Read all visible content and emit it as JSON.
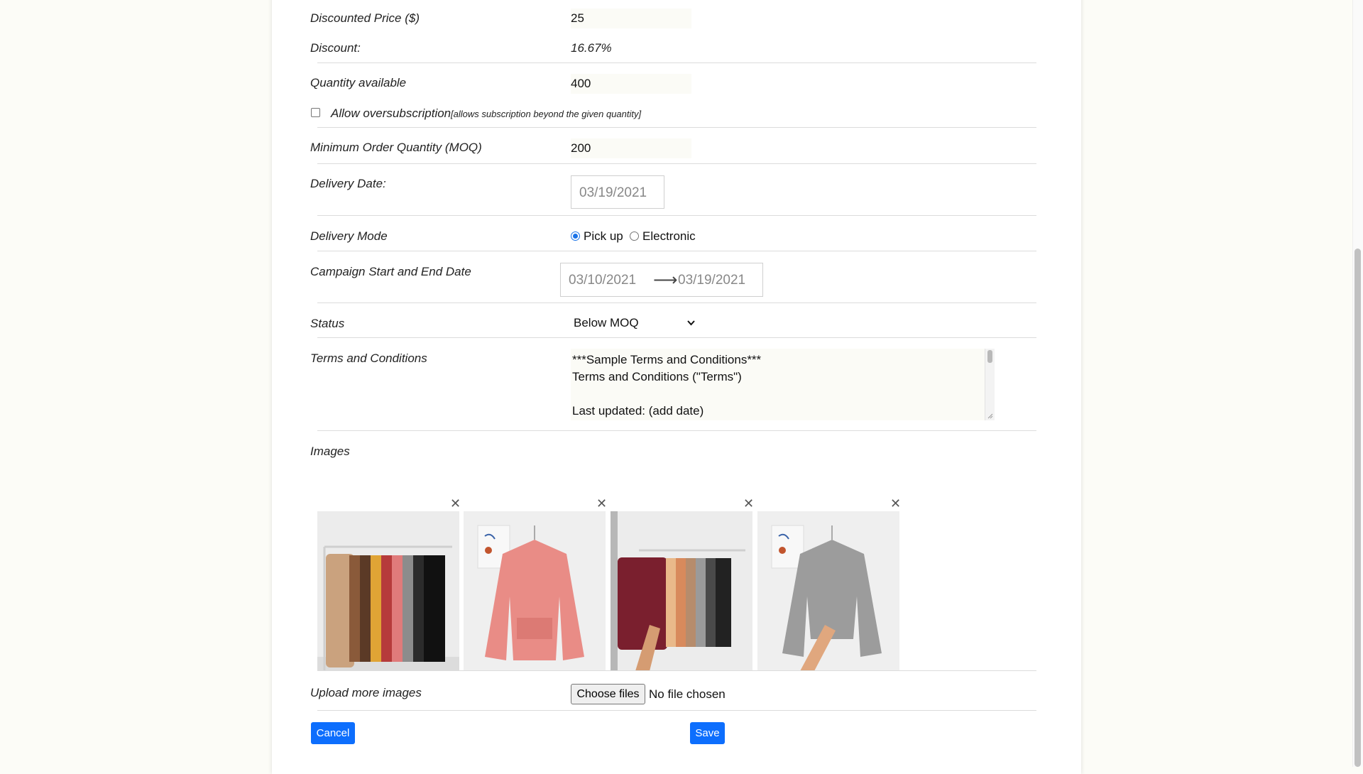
{
  "form": {
    "discounted_price_label": "Discounted Price ($)",
    "discounted_price_value": "25",
    "discount_label": "Discount:",
    "discount_value": "16.67%",
    "quantity_label": "Quantity available",
    "quantity_value": "400",
    "oversubscription_label": "Allow oversubscription",
    "oversubscription_note": "[allows subscription beyond the given quantity]",
    "oversubscription_checked": false,
    "moq_label": "Minimum Order Quantity (MOQ)",
    "moq_value": "200",
    "delivery_date_label": "Delivery Date:",
    "delivery_date_value": "03/19/2021",
    "delivery_mode_label": "Delivery Mode",
    "delivery_mode_options": [
      "Pick up",
      "Electronic"
    ],
    "delivery_mode_selected": "Pick up",
    "campaign_label": "Campaign Start and End Date",
    "campaign_start": "03/10/2021",
    "campaign_arrow": "⟶",
    "campaign_end": "03/19/2021",
    "status_label": "Status",
    "status_value": "Below MOQ",
    "terms_label": "Terms and Conditions",
    "terms_line1": "***Sample Terms and Conditions***",
    "terms_line2": "Terms and Conditions (\"Terms\")",
    "terms_line3": "Last updated: (add date)",
    "images_label": "Images",
    "upload_label": "Upload more images",
    "choose_files_label": "Choose files",
    "no_file_text": "No file chosen",
    "cancel_label": "Cancel",
    "save_label": "Save"
  },
  "images": [
    {
      "name": "beige hoodie rack",
      "colors": [
        "#caa27e",
        "#d7b08c",
        "#8a5a3a",
        "#5b3a26",
        "#e0a435",
        "#b63b3b",
        "#e07b7b",
        "#8c8c8c",
        "#2b2b2b",
        "#111"
      ]
    },
    {
      "name": "pink hoodie",
      "colors": [
        "#e98c86"
      ]
    },
    {
      "name": "burgundy hoodie rack",
      "colors": [
        "#7a1f2e",
        "#e9b98a",
        "#d88a5c",
        "#b68c6c",
        "#9a9a9a",
        "#4a4a4a",
        "#222"
      ]
    },
    {
      "name": "gray hoodie",
      "colors": [
        "#9c9c9c"
      ]
    }
  ],
  "colors": {
    "accent": "#0d6efd",
    "radio_accent": "#1a73e8",
    "page_bg": "#fcfcf7"
  }
}
